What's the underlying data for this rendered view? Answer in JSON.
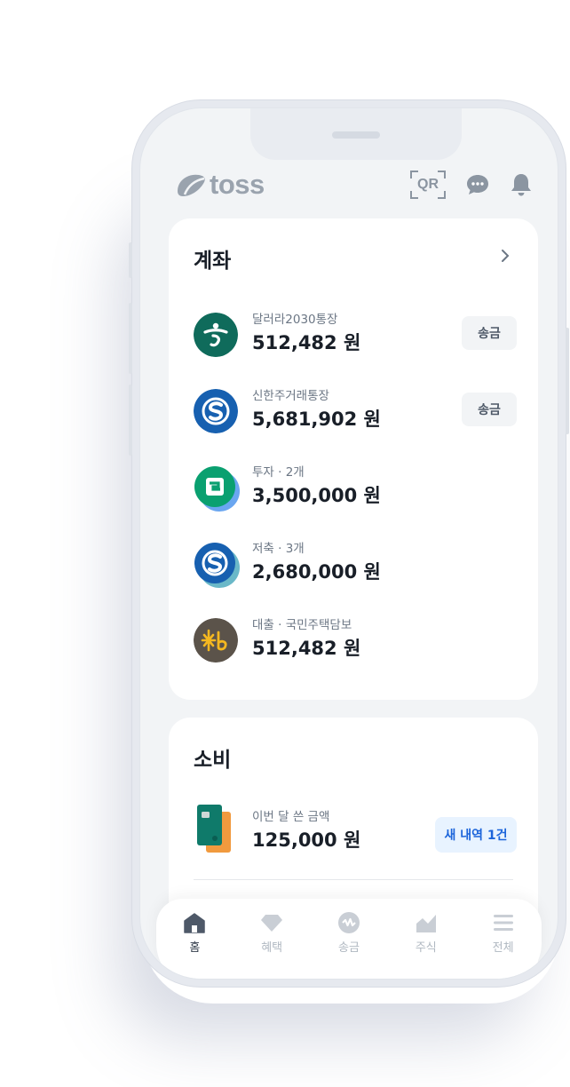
{
  "app": {
    "logo_text": "toss"
  },
  "header": {
    "qr_label": "QR"
  },
  "accounts": {
    "title": "계좌",
    "items": [
      {
        "name": "달러라2030통장",
        "amount": "512,482 원",
        "bank_icon": "hana-bank-icon",
        "action": "송금",
        "color": "#0f6b5b"
      },
      {
        "name": "신한주거래통장",
        "amount": "5,681,902 원",
        "bank_icon": "shinhan-bank-icon",
        "action": "송금",
        "color": "#1760b0"
      },
      {
        "name": "투자 · 2개",
        "amount": "3,500,000 원",
        "bank_icon": "investment-icon",
        "color": "#0aa070"
      },
      {
        "name": "저축 · 3개",
        "amount": "2,680,000 원",
        "bank_icon": "shinhan-bank-icon",
        "color": "#1760b0"
      },
      {
        "name": "대출 · 국민주택담보",
        "amount": "512,482 원",
        "bank_icon": "kb-bank-icon",
        "color": "#5b534a"
      }
    ]
  },
  "spending": {
    "title": "소비",
    "label": "이번 달 쓴 금액",
    "amount": "125,000 원",
    "badge": "새 내역 1건"
  },
  "tabs": [
    {
      "label": "홈",
      "icon": "home-icon",
      "active": true
    },
    {
      "label": "혜택",
      "icon": "gem-icon",
      "active": false
    },
    {
      "label": "송금",
      "icon": "transfer-icon",
      "active": false
    },
    {
      "label": "주식",
      "icon": "stock-icon",
      "active": false
    },
    {
      "label": "전체",
      "icon": "menu-icon",
      "active": false
    }
  ],
  "colors": {
    "accent": "#1b64da",
    "background": "#f2f4f6"
  }
}
